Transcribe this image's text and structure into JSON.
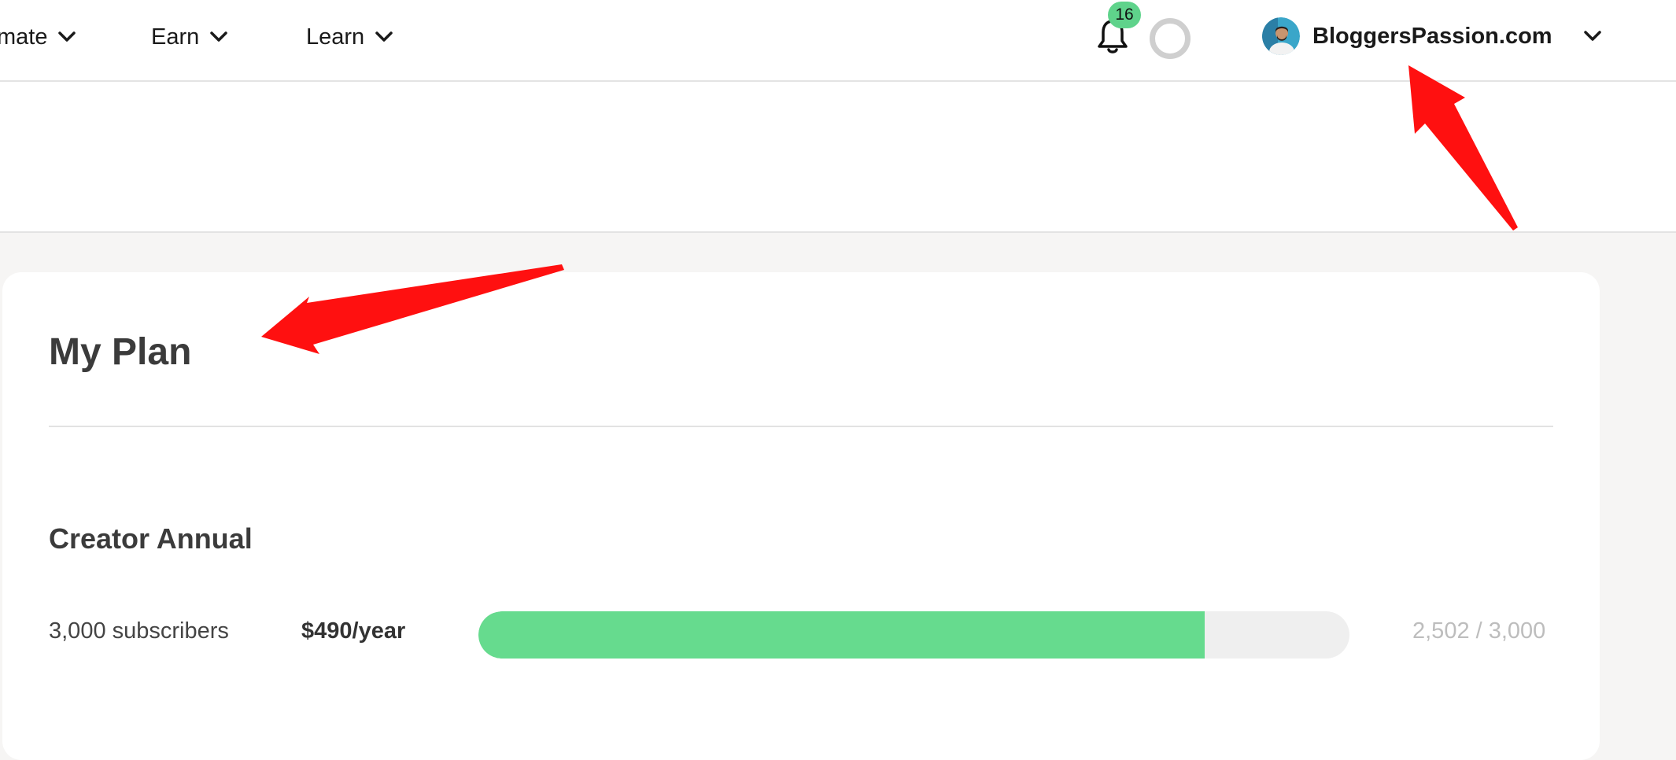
{
  "nav": {
    "items": [
      {
        "label": "mate"
      },
      {
        "label": "Earn"
      },
      {
        "label": "Learn"
      }
    ],
    "notifications": {
      "count": "16",
      "icon": "bell-icon"
    },
    "account": {
      "name": "BloggersPassion.com",
      "icon": "avatar"
    }
  },
  "plan": {
    "title": "My Plan",
    "name": "Creator Annual",
    "subscribers_label": "3,000 subscribers",
    "price": "$490/year",
    "usage_text": "2,502 / 3,000",
    "usage_fraction": 0.834
  },
  "colors": {
    "accent_green": "#66db8e",
    "badge_green": "#5fd38b",
    "annotation_red": "#ff1010"
  }
}
